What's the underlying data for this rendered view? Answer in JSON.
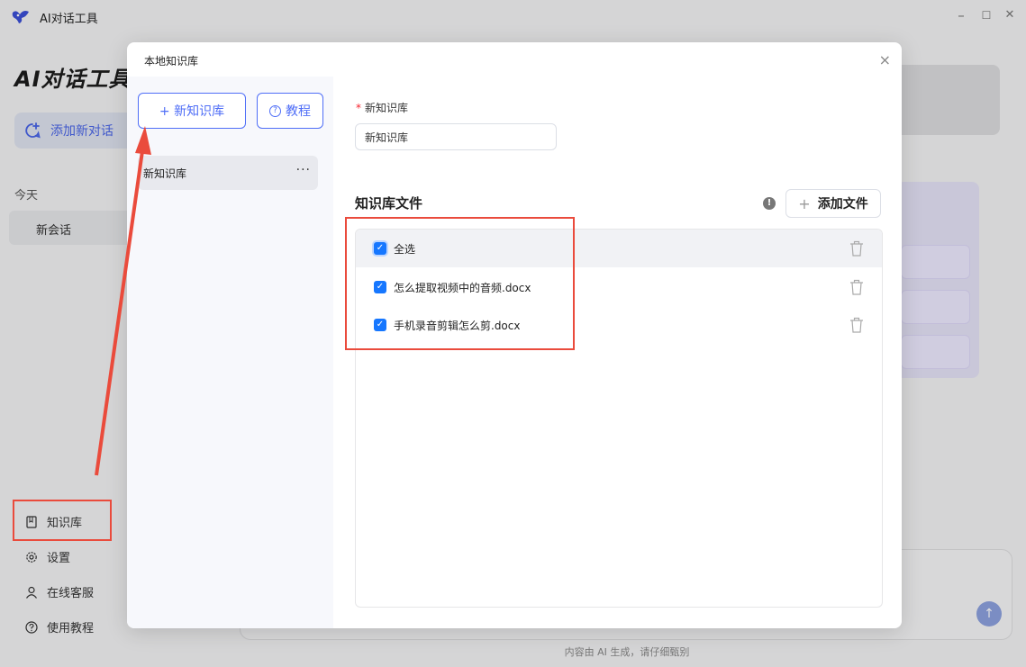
{
  "app": {
    "title": "AI对话工具",
    "brand": "AI对话工具",
    "add_chat": "添加新对话",
    "section_today": "今天",
    "chat_item": "新会话",
    "nav": {
      "kb": "知识库",
      "settings": "设置",
      "support": "在线客服",
      "tutorial": "使用教程"
    },
    "footer_note": "内容由 AI 生成，请仔细甄别",
    "window_controls": [
      "–",
      "☐",
      "✕"
    ],
    "accent_color": "#4f6ef7"
  },
  "dialog": {
    "title": "本地知识库",
    "close": "×",
    "new_kb_button": "+ 新知识库",
    "tutorial_button": "教程",
    "kb_list": [
      {
        "name": "新知识库",
        "more": "···"
      }
    ],
    "name_label": "新知识库",
    "name_required_mark": "*",
    "name_value": "新知识库",
    "files_title": "知识库文件",
    "add_file_button": "添加文件",
    "select_all": "全选",
    "files": [
      "怎么提取视频中的音频.docx",
      "手机录音剪辑怎么剪.docx"
    ]
  }
}
